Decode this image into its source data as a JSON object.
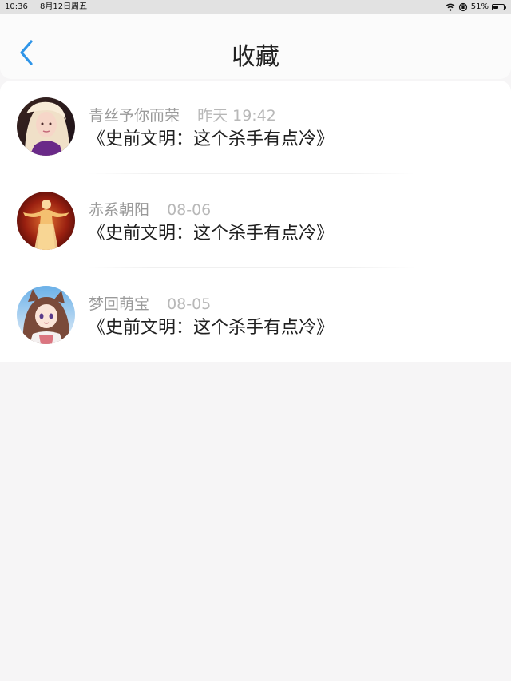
{
  "status_bar": {
    "time": "10:36",
    "date": "8月12日周五",
    "battery": "51%",
    "battery_level": 0.51
  },
  "nav": {
    "title": "收藏",
    "back_icon": "chevron-left-icon",
    "accent_color": "#2f95e8"
  },
  "favorites": [
    {
      "user": "青丝予你而荣",
      "time": "昨天 19:42",
      "title": "《史前文明：这个杀手有点冷》",
      "avatar": "avatar-blonde-girl"
    },
    {
      "user": "赤系朝阳",
      "time": "08-06",
      "title": "《史前文明：这个杀手有点冷》",
      "avatar": "avatar-golden-figure"
    },
    {
      "user": "梦回萌宝",
      "time": "08-05",
      "title": "《史前文明：这个杀手有点冷》",
      "avatar": "avatar-anime-girl"
    }
  ]
}
